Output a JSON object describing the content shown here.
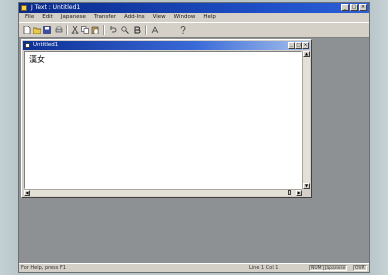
{
  "app": {
    "title": "J Text : Untitled1",
    "menu": [
      "File",
      "Edit",
      "Japanese",
      "Transfer",
      "Add-Ins",
      "View",
      "Window",
      "Help"
    ],
    "toolbar_icons": [
      "new-icon",
      "open-icon",
      "save-icon",
      "print-icon",
      "cut-icon",
      "copy-icon",
      "paste-icon",
      "undo-icon",
      "find-icon",
      "bold-icon",
      "font-icon",
      "help-icon"
    ]
  },
  "document": {
    "title": "Untitled1",
    "content": "漢女",
    "controls": {
      "minimize": "_",
      "maximize": "□",
      "close": "×"
    }
  },
  "statusbar": {
    "message": "For Help, press F1",
    "position": "Line 1 Col 1",
    "panes": [
      "NUM",
      "Japanese",
      "OVR"
    ]
  },
  "colors": {
    "titlebar": "#0a2a8a",
    "workspace": "#8e9193",
    "chrome": "#d4d0c8",
    "editor": "#ffffff"
  }
}
